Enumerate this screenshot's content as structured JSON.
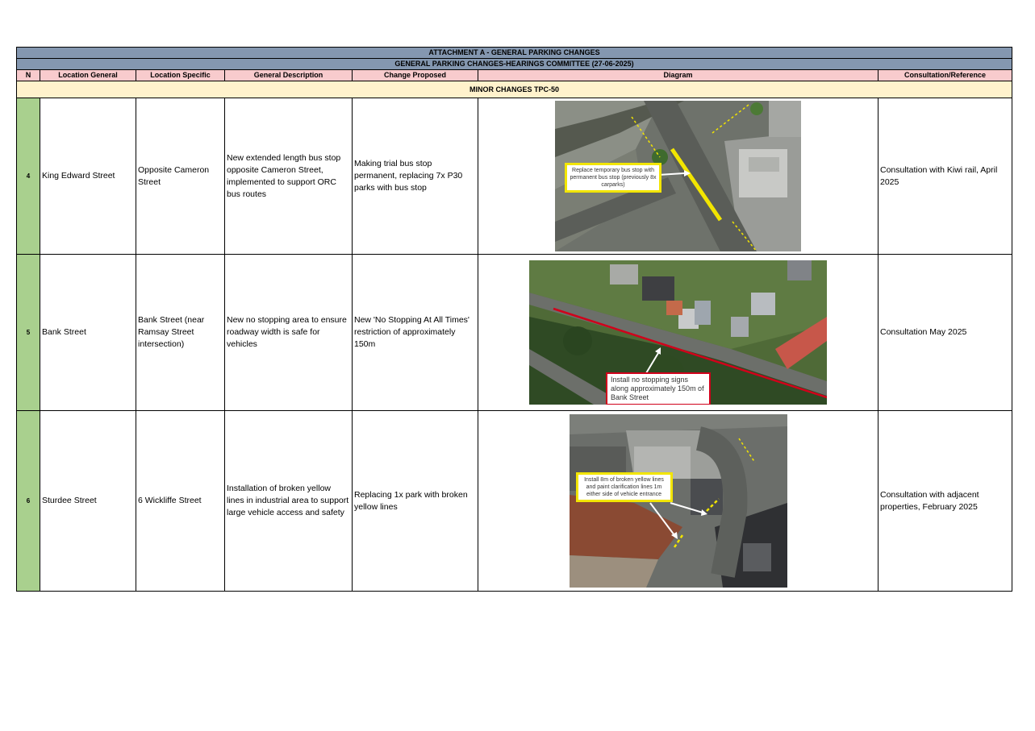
{
  "title": "ATTACHMENT A - GENERAL PARKING CHANGES",
  "subtitle": "GENERAL PARKING CHANGES-HEARINGS COMMITTEE (27-06-2025)",
  "headers": {
    "n": "N",
    "location_general": "Location General",
    "location_specific": "Location Specific",
    "general_description": "General Description",
    "change_proposed": "Change Proposed",
    "diagram": "Diagram",
    "consultation": "Consultation/Reference"
  },
  "section": "MINOR CHANGES TPC-50",
  "rows": [
    {
      "n": "4",
      "location_general": "King Edward Street",
      "location_specific": "Opposite Cameron Street",
      "general_description": "New extended length bus stop opposite Cameron Street, implemented to support ORC bus routes",
      "change_proposed": "Making trial bus stop permanent, replacing 7x P30 parks with bus stop",
      "diagram_callout": "Replace temporary bus stop with permanent bus stop (previously 8x carparks)",
      "consultation": "Consultation with Kiwi rail, April 2025"
    },
    {
      "n": "5",
      "location_general": "Bank Street",
      "location_specific": "Bank Street (near Ramsay Street intersection)",
      "general_description": "New no stopping area to ensure roadway width is safe for vehicles",
      "change_proposed": "New 'No Stopping At All Times' restriction of approximately 150m",
      "diagram_callout": "Install no stopping signs along approximately 150m of Bank Street",
      "consultation": "Consultation May 2025"
    },
    {
      "n": "6",
      "location_general": "Sturdee Street",
      "location_specific": "6 Wickliffe Street",
      "general_description": "Installation of broken yellow lines in industrial area to support large vehicle access and safety",
      "change_proposed": "Replacing 1x park with broken yellow lines",
      "diagram_callout": "Install 8m of broken yellow lines and paint clarification lines 1m either side of vehicle entrance",
      "consultation": "Consultation with adjacent properties, February 2025"
    }
  ],
  "colors": {
    "title_bg": "#8497b0",
    "header_bg": "#f8cbcd",
    "section_bg": "#fff2cc",
    "number_bg": "#a9d08e",
    "yellow_marking": "#f2e500",
    "red_marking": "#d0021b"
  }
}
